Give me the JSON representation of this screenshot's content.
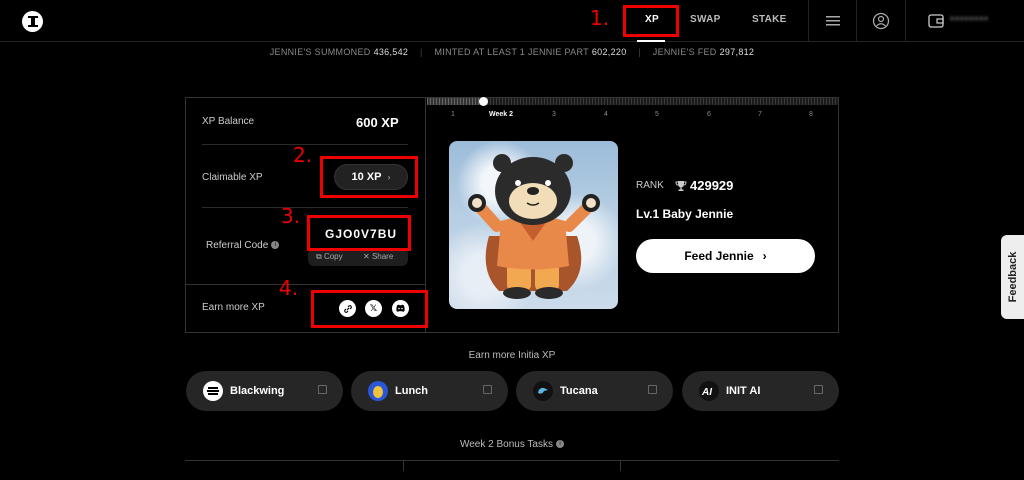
{
  "nav": {
    "links": [
      "XP",
      "SWAP",
      "STAKE"
    ],
    "wallet_masked": "••••••••"
  },
  "stats": [
    {
      "label": "JENNIE'S SUMMONED",
      "value": "436,542"
    },
    {
      "label": "MINTED AT LEAST 1 JENNIE PART",
      "value": "602,220"
    },
    {
      "label": "JENNIE'S FED",
      "value": "297,812"
    }
  ],
  "xp_panel": {
    "balance_label": "XP Balance",
    "balance_value": "600 XP",
    "claimable_label": "Claimable XP",
    "claimable_value": "10 XP",
    "referral_label": "Referral Code",
    "referral_code": "GJO0V7BU",
    "copy_label": "Copy",
    "share_label": "Share",
    "earn_label": "Earn more XP"
  },
  "weeks": {
    "labels": [
      "1",
      "Week 2",
      "3",
      "4",
      "5",
      "6",
      "7",
      "8"
    ],
    "current_index": 1
  },
  "jennie": {
    "rank_label": "RANK",
    "rank_value": "429929",
    "level_name": "Lv.1 Baby Jennie",
    "feed_label": "Feed Jennie"
  },
  "annotations": [
    "1.",
    "2.",
    "3.",
    "4."
  ],
  "earn_initia": {
    "title": "Earn more Initia XP",
    "partners": [
      {
        "name": "Blackwing",
        "color": "#ffffff"
      },
      {
        "name": "Lunch",
        "color": "#f0c33c"
      },
      {
        "name": "Tucana",
        "color": "#5bb6e6"
      },
      {
        "name": "INIT AI",
        "color": "#111111"
      }
    ]
  },
  "bonus_title": "Week 2 Bonus Tasks",
  "feedback_label": "Feedback"
}
